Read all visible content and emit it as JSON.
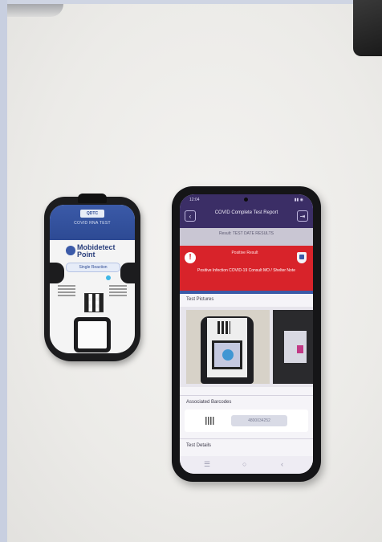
{
  "device": {
    "brand_tag": "QDTC",
    "band_text": "COVID RNA TEST",
    "logo_text": "Mobidetect Point",
    "pill_text": "Single Reaction"
  },
  "phone": {
    "status_time": "12:04",
    "status_icons": "▮▮ ◉",
    "back_icon": "back-arrow-icon",
    "exit_icon": "exit-icon",
    "appbar_title": "COVID Complete Test Report",
    "banner_text": "Result: TEST DATE RESULTS",
    "alert": {
      "symbol": "!",
      "heading": "Positive Result",
      "body": "Positive Infection COVID-19 Consult MO / Shelter Note"
    },
    "section_photos": "Test Pictures",
    "section_barcodes": "Associated Barcodes",
    "barcode_value": "4800034252",
    "section_details": "Test Details",
    "nav": [
      "☰",
      "○",
      "‹"
    ]
  },
  "colors": {
    "app_primary": "#3b2e66",
    "alert_red": "#d8232a",
    "device_blue": "#3b5aa8"
  }
}
